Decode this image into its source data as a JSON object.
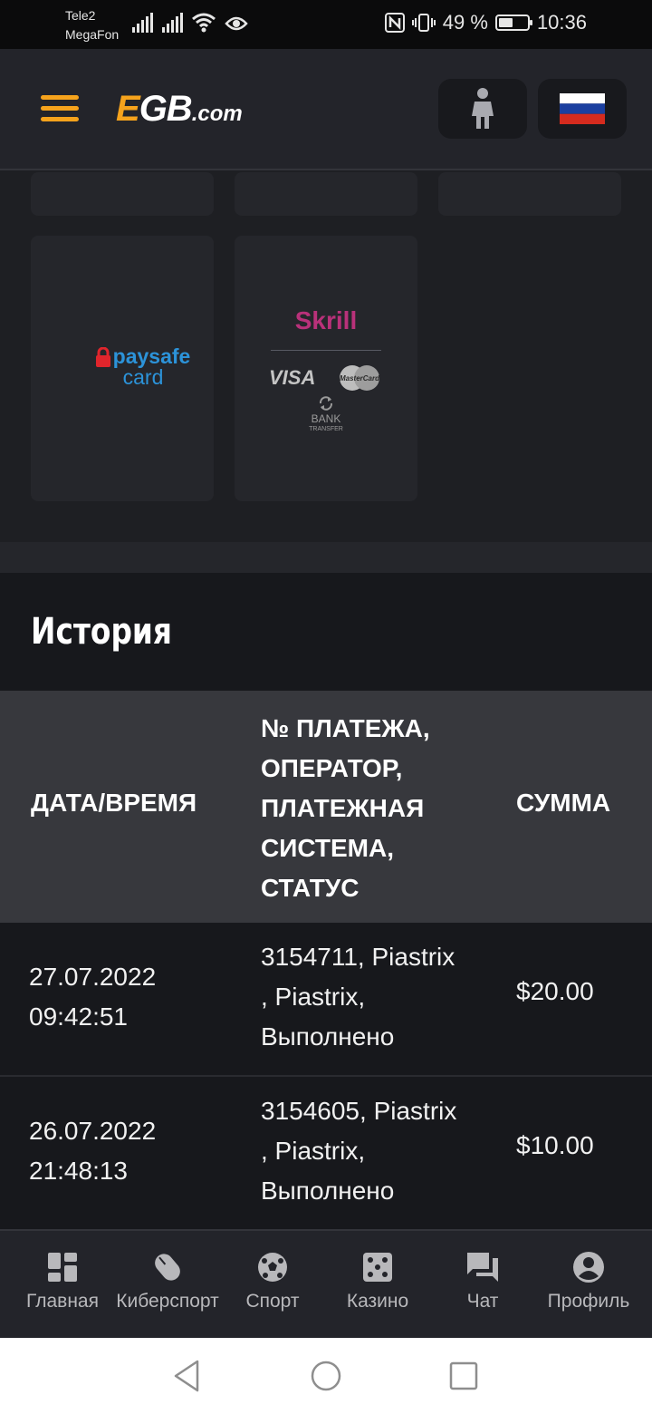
{
  "status_bar": {
    "carrier1": "Tele2",
    "carrier2": "MegaFon",
    "battery": "49 %",
    "battery_level": 0.49,
    "time": "10:36"
  },
  "header": {
    "logo_main": "GB",
    "logo_e": "E",
    "logo_suffix": ".com",
    "accent_color": "#f6a31c"
  },
  "payment_methods": {
    "paysafe_line1": "paysafe",
    "paysafe_line2": "card",
    "skrill": "Skrill",
    "visa": "VISA",
    "mastercard": "MasterCard",
    "bank_line1": "BANK",
    "bank_line2": "TRANSFER"
  },
  "history": {
    "title": "История",
    "columns": {
      "date": "ДАТА/ВРЕМЯ",
      "payment": "№ ПЛАТЕЖА, ОПЕРАТОР, ПЛАТЕЖНАЯ СИСТЕМА, СТАТУС",
      "amount": "СУММА"
    },
    "rows": [
      {
        "date": "27.07.2022",
        "time": "09:42:51",
        "line1": "3154711, Piastrix",
        "line2": ", Piastrix,",
        "line3": "Выполнено",
        "amount": "$20.00"
      },
      {
        "date": "26.07.2022",
        "time": "21:48:13",
        "line1": "3154605, Piastrix",
        "line2": ", Piastrix,",
        "line3": "Выполнено",
        "amount": "$10.00"
      }
    ]
  },
  "bottom_nav": [
    {
      "label": "Главная",
      "icon": "dashboard-icon"
    },
    {
      "label": "Киберспорт",
      "icon": "mouse-icon"
    },
    {
      "label": "Спорт",
      "icon": "soccer-ball-icon"
    },
    {
      "label": "Казино",
      "icon": "dice-icon"
    },
    {
      "label": "Чат",
      "icon": "chat-icon"
    },
    {
      "label": "Профиль",
      "icon": "profile-icon"
    }
  ]
}
